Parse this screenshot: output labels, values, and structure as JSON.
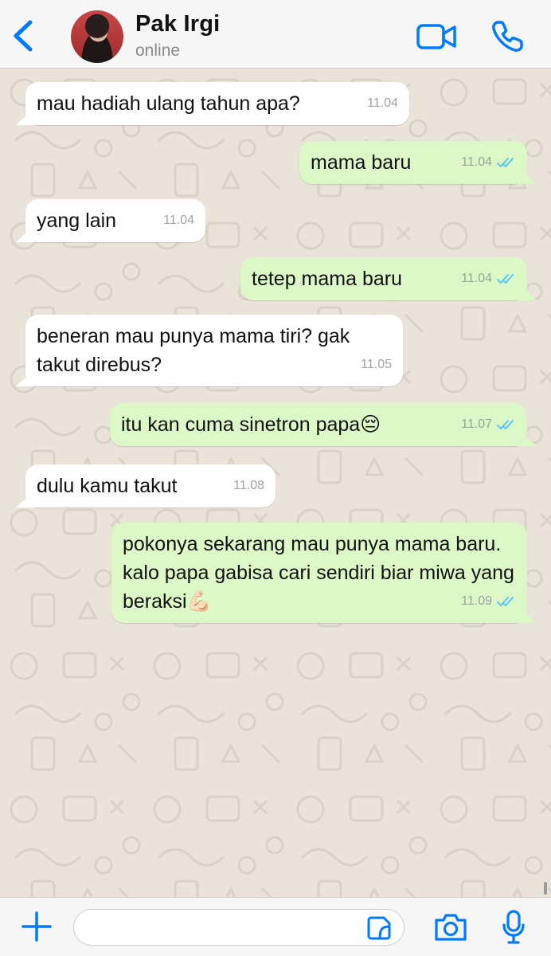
{
  "header": {
    "contact_name": "Pak Irgi",
    "status": "online"
  },
  "colors": {
    "accent": "#007aff",
    "incoming_bubble": "#ffffff",
    "outgoing_bubble": "#dcf8c6",
    "read_ticks": "#4fc3f7",
    "wallpaper": "#e9e3da"
  },
  "messages": [
    {
      "direction": "in",
      "text": "mau hadiah ulang tahun apa?",
      "time": "11.04"
    },
    {
      "direction": "out",
      "text": "mama baru",
      "time": "11.04",
      "status": "read"
    },
    {
      "direction": "in",
      "text": "yang lain",
      "time": "11.04"
    },
    {
      "direction": "out",
      "text": "tetep mama baru",
      "time": "11.04",
      "status": "read"
    },
    {
      "direction": "in",
      "text": "beneran mau punya mama tiri? gak takut direbus?",
      "time": "11.05"
    },
    {
      "direction": "out",
      "text": "itu kan cuma sinetron papa😔",
      "time": "11.07",
      "status": "read"
    },
    {
      "direction": "in",
      "text": "dulu kamu takut",
      "time": "11.08"
    },
    {
      "direction": "out",
      "text": "pokonya sekarang mau punya mama baru. kalo papa gabisa cari sendiri biar miwa yang beraksi💪🏻",
      "time": "11.09",
      "status": "read"
    }
  ],
  "composer": {
    "value": "",
    "placeholder": ""
  },
  "icons": {
    "back": "chevron-left-icon",
    "video": "video-camera-icon",
    "call": "phone-icon",
    "attach": "plus-icon",
    "sticker": "sticker-icon",
    "camera": "camera-icon",
    "mic": "microphone-icon"
  }
}
